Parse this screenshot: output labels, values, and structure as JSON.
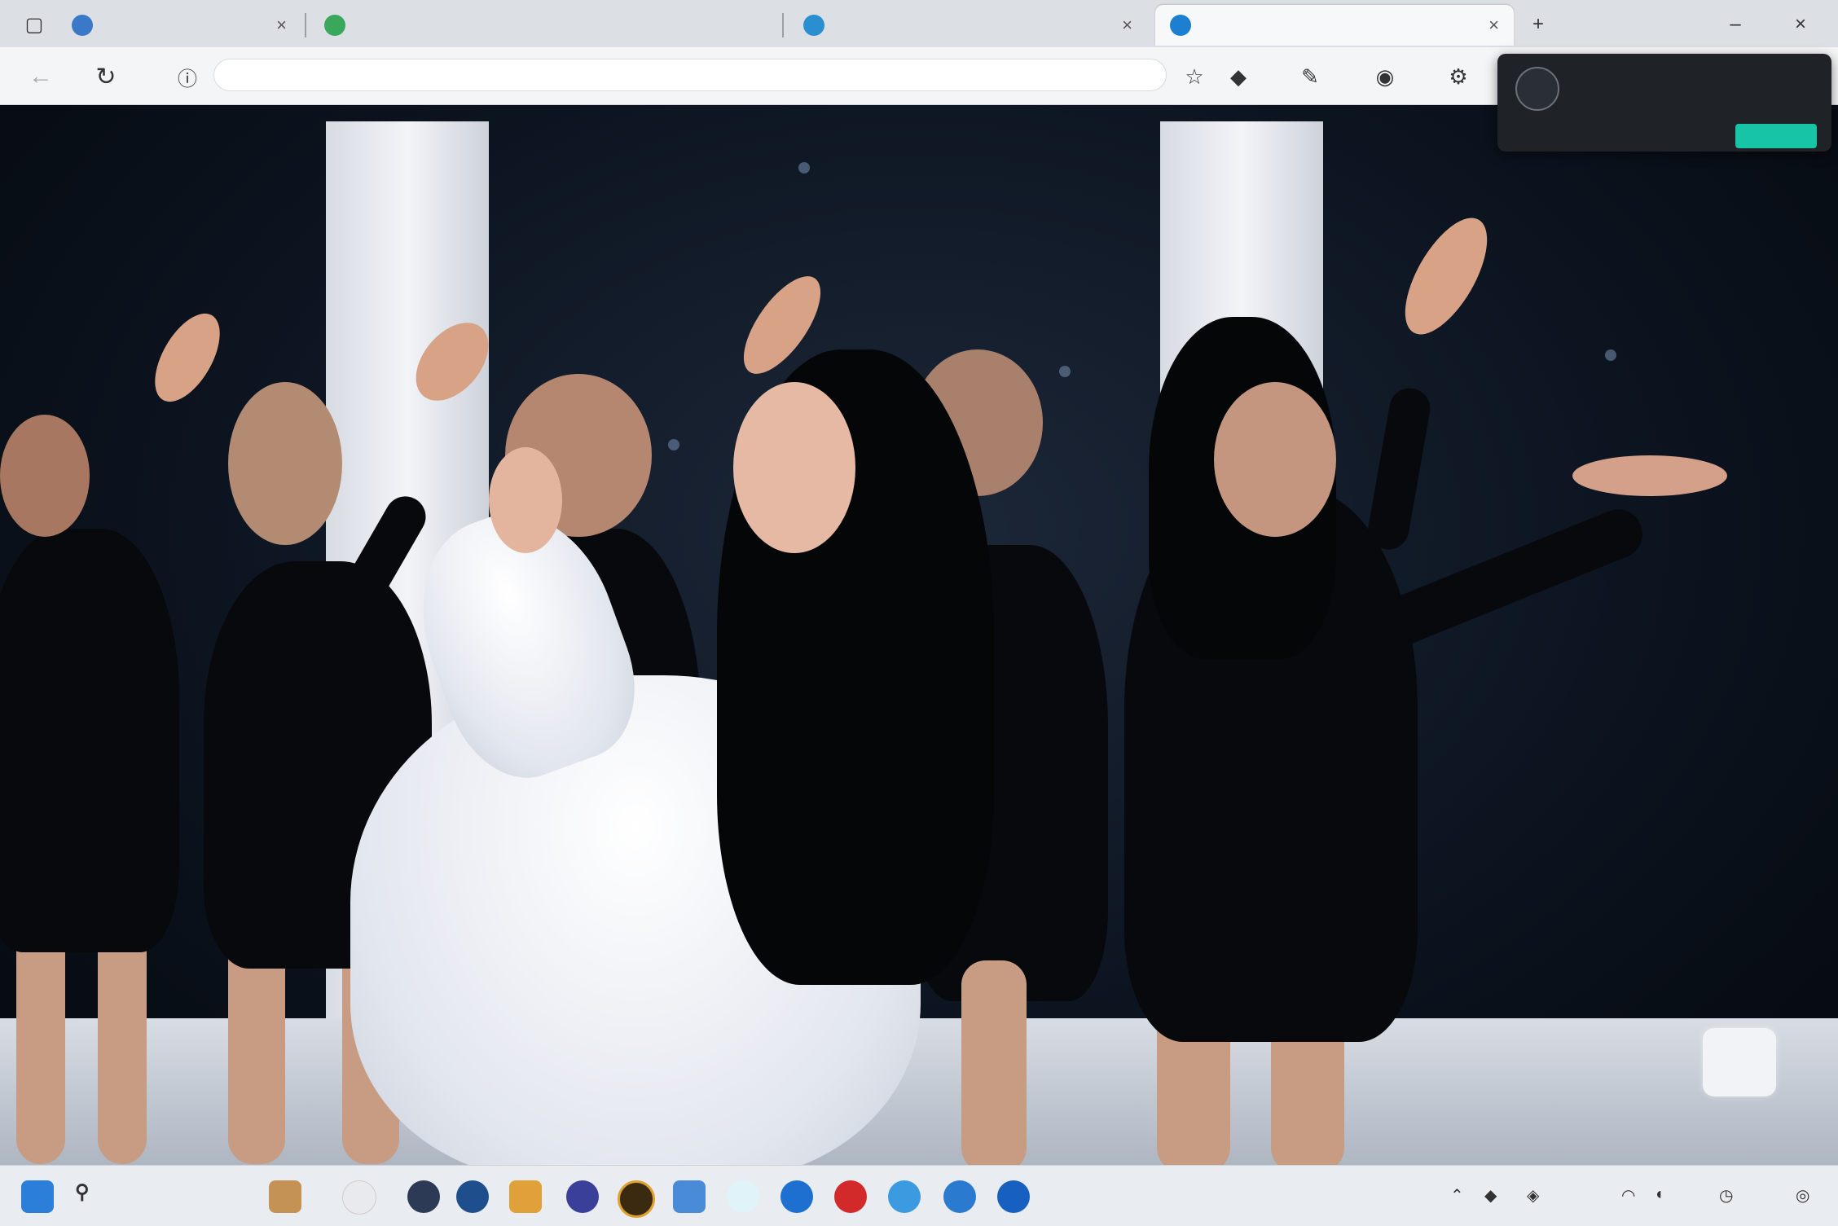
{
  "browser": {
    "tabs": [
      {
        "label": "",
        "favicon_color": "#3a78c8",
        "active": false
      },
      {
        "label": "",
        "favicon_color": "#3aa85a",
        "active": false
      },
      {
        "label": "",
        "favicon_color": "#2a8fd0",
        "active": false
      },
      {
        "label": "",
        "favicon_color": "#1c7fd0",
        "active": true
      }
    ],
    "url": ""
  },
  "popup": {
    "title": "",
    "badge": "",
    "message": "",
    "button_label": ""
  },
  "taskbar": {
    "search_label": ""
  },
  "colors": {
    "popup_accent": "#17c4a6",
    "popup_badge": "#ffb037"
  }
}
